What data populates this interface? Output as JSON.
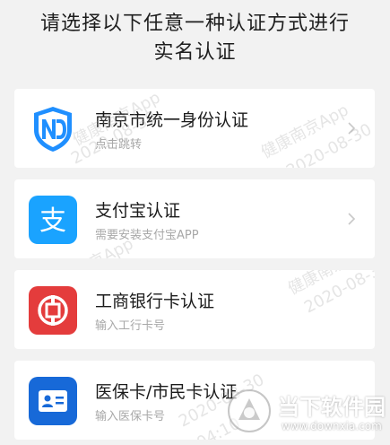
{
  "header": {
    "title_line1": "请选择以下任意一种认证方式进行",
    "title_line2": "实名认证"
  },
  "options": [
    {
      "title": "南京市统一身份认证",
      "subtitle": "点击跳转",
      "icon": "nd-shield-icon",
      "color": "#1f8fff"
    },
    {
      "title": "支付宝认证",
      "subtitle": "需要安装支付宝APP",
      "icon": "alipay-icon",
      "color": "#1aa3ff"
    },
    {
      "title": "工商银行卡认证",
      "subtitle": "输入工行卡号",
      "icon": "icbc-icon",
      "color": "#e43c3c"
    },
    {
      "title": "医保卡/市民卡认证",
      "subtitle": "输入医保卡号",
      "icon": "id-card-icon",
      "color": "#1769d8"
    }
  ],
  "watermark": {
    "app": "健康南京App",
    "date": "2020-08-30",
    "time": "04:10"
  },
  "brand": {
    "name": "当下软件园",
    "url": "www.downxia.com"
  }
}
